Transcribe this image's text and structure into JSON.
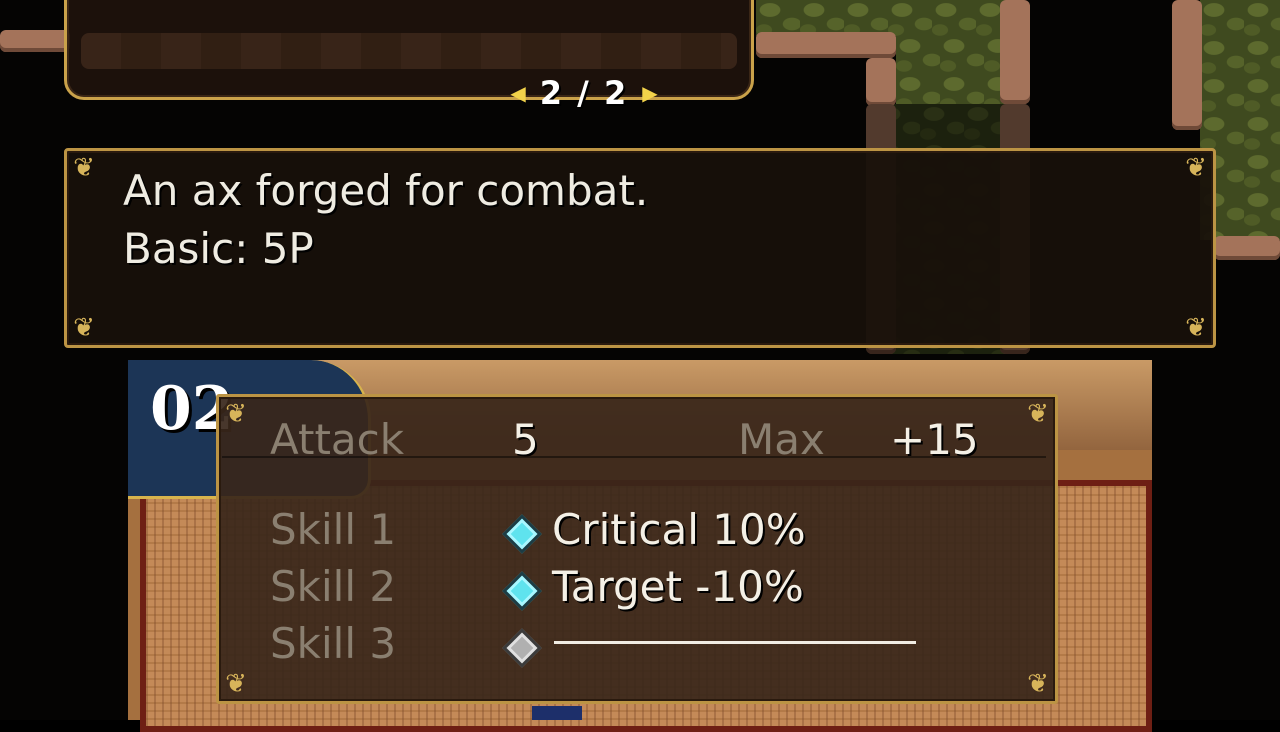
{
  "pager": {
    "text": "2 / 2"
  },
  "description": {
    "line1": "An ax forged for combat.",
    "line2": "Basic: 5P"
  },
  "equipment": {
    "slot_number": "02",
    "attack_label": "Attack",
    "attack_value": "5",
    "max_label": "Max",
    "max_value": "+15",
    "skills": [
      {
        "label": "Skill 1",
        "value": "Critical 10%",
        "gem": "cyan-gem-icon"
      },
      {
        "label": "Skill 2",
        "value": "Target -10%",
        "gem": "cyan-gem-icon"
      },
      {
        "label": "Skill 3",
        "value": "",
        "gem": "grey-gem-icon"
      }
    ]
  },
  "colors": {
    "frame_gold": "#bc9444",
    "panel_brown": "#38261a",
    "gem_cyan": "#5fe3ee",
    "gem_grey": "#b0b0b0"
  }
}
